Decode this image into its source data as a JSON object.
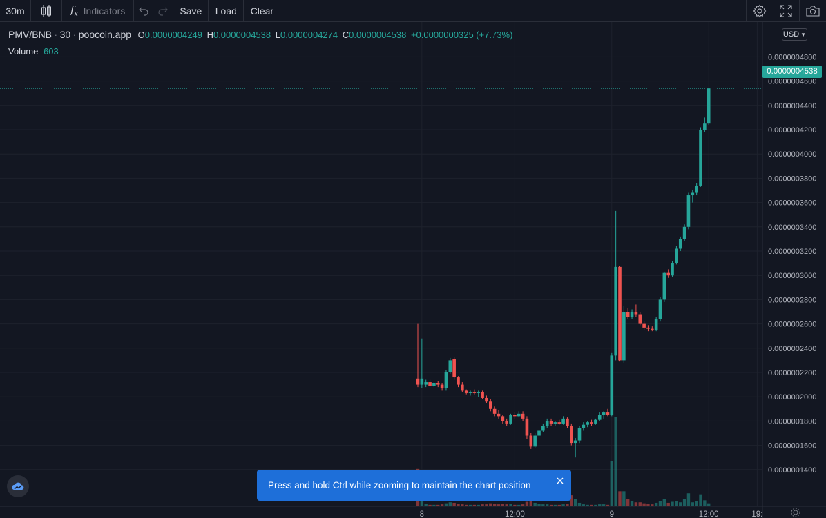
{
  "toolbar": {
    "interval": "30m",
    "indicators_label": "Indicators",
    "save_label": "Save",
    "load_label": "Load",
    "clear_label": "Clear"
  },
  "legend": {
    "symbol": "PMV/BNB",
    "interval": "30",
    "source": "poocoin.app",
    "o_key": "O",
    "o_val": "0.0000004249",
    "h_key": "H",
    "h_val": "0.0000004538",
    "l_key": "L",
    "l_val": "0.0000004274",
    "c_key": "C",
    "c_val": "0.0000004538",
    "change": "+0.0000000325 (+7.73%)",
    "volume_label": "Volume",
    "volume_value": "603"
  },
  "currency_button": "USD",
  "last_price": "0.0000004538",
  "toast": {
    "message": "Press and hold Ctrl while zooming to maintain the chart position"
  },
  "colors": {
    "up": "#26a69a",
    "down": "#ef5350",
    "background": "#131722",
    "grid": "#1e222d",
    "toast": "#1e6fd9"
  },
  "chart_data": {
    "type": "candlestick",
    "y_ticks": [
      "0.0000004800",
      "0.0000004600",
      "0.0000004400",
      "0.0000004200",
      "0.0000004000",
      "0.0000003800",
      "0.0000003600",
      "0.0000003400",
      "0.0000003200",
      "0.0000003000",
      "0.0000002800",
      "0.0000002600",
      "0.0000002400",
      "0.0000002200",
      "0.0000002000",
      "0.0000001800",
      "0.0000001600",
      "0.0000001400"
    ],
    "y_tick_values": [
      4.8,
      4.6,
      4.4,
      4.2,
      4.0,
      3.8,
      3.6,
      3.4,
      3.2,
      3.0,
      2.8,
      2.6,
      2.4,
      2.2,
      2.0,
      1.8,
      1.6,
      1.4
    ],
    "y_unit_note": "values in units of 1e-7",
    "ylim": [
      1.2,
      4.95
    ],
    "x_ticks": [
      {
        "label": "8",
        "index": 1
      },
      {
        "label": "12:00",
        "index": 24
      },
      {
        "label": "9",
        "index": 48
      },
      {
        "label": "12:00",
        "index": 72
      },
      {
        "label": "19:",
        "index": 84
      }
    ],
    "candles": [
      [
        2.15,
        2.6,
        2.08,
        2.1,
        7.5
      ],
      [
        2.1,
        2.48,
        2.07,
        2.15,
        6.5
      ],
      [
        2.1,
        2.14,
        2.08,
        2.12,
        0.5
      ],
      [
        2.12,
        2.14,
        2.09,
        2.09,
        0.3
      ],
      [
        2.09,
        2.12,
        2.08,
        2.11,
        0.3
      ],
      [
        2.11,
        2.13,
        2.08,
        2.1,
        0.3
      ],
      [
        2.1,
        2.11,
        2.05,
        2.07,
        0.4
      ],
      [
        2.07,
        2.22,
        2.05,
        2.2,
        0.6
      ],
      [
        2.2,
        2.32,
        2.19,
        2.3,
        0.8
      ],
      [
        2.31,
        2.33,
        2.14,
        2.16,
        0.7
      ],
      [
        2.16,
        2.17,
        2.08,
        2.1,
        0.5
      ],
      [
        2.1,
        2.12,
        2.04,
        2.05,
        0.4
      ],
      [
        2.05,
        2.06,
        2.02,
        2.03,
        0.3
      ],
      [
        2.03,
        2.05,
        2.01,
        2.04,
        0.3
      ],
      [
        2.04,
        2.06,
        2.02,
        2.03,
        0.3
      ],
      [
        2.03,
        2.05,
        2.0,
        2.04,
        0.3
      ],
      [
        2.04,
        2.05,
        1.98,
        1.99,
        0.4
      ],
      [
        1.99,
        2.01,
        1.95,
        1.96,
        0.4
      ],
      [
        1.96,
        1.98,
        1.88,
        1.9,
        0.6
      ],
      [
        1.9,
        1.92,
        1.84,
        1.86,
        0.5
      ],
      [
        1.86,
        1.89,
        1.82,
        1.84,
        0.4
      ],
      [
        1.84,
        1.85,
        1.78,
        1.8,
        0.5
      ],
      [
        1.8,
        1.82,
        1.76,
        1.78,
        0.4
      ],
      [
        1.78,
        1.86,
        1.77,
        1.85,
        0.5
      ],
      [
        1.85,
        1.87,
        1.82,
        1.84,
        0.3
      ],
      [
        1.84,
        1.88,
        1.83,
        1.86,
        0.3
      ],
      [
        1.86,
        1.88,
        1.8,
        1.82,
        0.4
      ],
      [
        1.82,
        1.84,
        1.65,
        1.68,
        0.9
      ],
      [
        1.68,
        1.7,
        1.57,
        1.59,
        1.0
      ],
      [
        1.59,
        1.7,
        1.58,
        1.68,
        0.7
      ],
      [
        1.68,
        1.74,
        1.66,
        1.72,
        0.5
      ],
      [
        1.72,
        1.78,
        1.71,
        1.76,
        0.4
      ],
      [
        1.76,
        1.82,
        1.74,
        1.8,
        0.4
      ],
      [
        1.8,
        1.82,
        1.76,
        1.78,
        0.3
      ],
      [
        1.78,
        1.8,
        1.76,
        1.79,
        0.3
      ],
      [
        1.79,
        1.81,
        1.77,
        1.78,
        0.3
      ],
      [
        1.78,
        1.84,
        1.77,
        1.82,
        0.4
      ],
      [
        1.82,
        1.83,
        1.74,
        1.76,
        0.5
      ],
      [
        1.76,
        1.78,
        1.6,
        1.62,
        2.2
      ],
      [
        1.62,
        1.66,
        1.5,
        1.64,
        1.4
      ],
      [
        1.64,
        1.76,
        1.62,
        1.74,
        0.7
      ],
      [
        1.74,
        1.79,
        1.72,
        1.77,
        0.4
      ],
      [
        1.77,
        1.8,
        1.75,
        1.79,
        0.3
      ],
      [
        1.79,
        1.81,
        1.76,
        1.78,
        0.3
      ],
      [
        1.78,
        1.82,
        1.77,
        1.81,
        0.3
      ],
      [
        1.81,
        1.87,
        1.8,
        1.85,
        0.4
      ],
      [
        1.85,
        1.88,
        1.82,
        1.87,
        0.4
      ],
      [
        1.87,
        1.9,
        1.84,
        1.85,
        0.3
      ],
      [
        1.85,
        2.36,
        1.84,
        2.34,
        9.0
      ],
      [
        2.34,
        3.53,
        2.3,
        3.07,
        18.0
      ],
      [
        3.07,
        3.08,
        2.29,
        2.3,
        3.0
      ],
      [
        2.3,
        2.75,
        2.28,
        2.7,
        3.0
      ],
      [
        2.7,
        2.73,
        2.64,
        2.66,
        1.5
      ],
      [
        2.66,
        2.72,
        2.64,
        2.7,
        1.0
      ],
      [
        2.7,
        2.76,
        2.66,
        2.68,
        0.8
      ],
      [
        2.68,
        2.7,
        2.59,
        2.6,
        0.8
      ],
      [
        2.6,
        2.62,
        2.55,
        2.57,
        0.6
      ],
      [
        2.57,
        2.59,
        2.54,
        2.56,
        0.5
      ],
      [
        2.56,
        2.58,
        2.54,
        2.55,
        0.4
      ],
      [
        2.55,
        2.66,
        2.54,
        2.64,
        0.7
      ],
      [
        2.64,
        2.82,
        2.62,
        2.8,
        1.0
      ],
      [
        2.8,
        3.03,
        2.78,
        3.02,
        1.4
      ],
      [
        3.02,
        3.05,
        2.98,
        3.0,
        0.7
      ],
      [
        3.0,
        3.12,
        2.99,
        3.1,
        0.9
      ],
      [
        3.1,
        3.24,
        3.09,
        3.22,
        1.0
      ],
      [
        3.22,
        3.32,
        3.2,
        3.3,
        0.8
      ],
      [
        3.3,
        3.42,
        3.28,
        3.4,
        1.4
      ],
      [
        3.4,
        3.68,
        3.38,
        3.66,
        2.6
      ],
      [
        3.66,
        3.7,
        3.6,
        3.68,
        0.8
      ],
      [
        3.68,
        3.76,
        3.66,
        3.74,
        1.0
      ],
      [
        3.74,
        4.22,
        3.73,
        4.2,
        2.4
      ],
      [
        4.2,
        4.3,
        4.18,
        4.25,
        1.2
      ],
      [
        4.25,
        4.54,
        4.24,
        4.54,
        0.6
      ]
    ]
  }
}
